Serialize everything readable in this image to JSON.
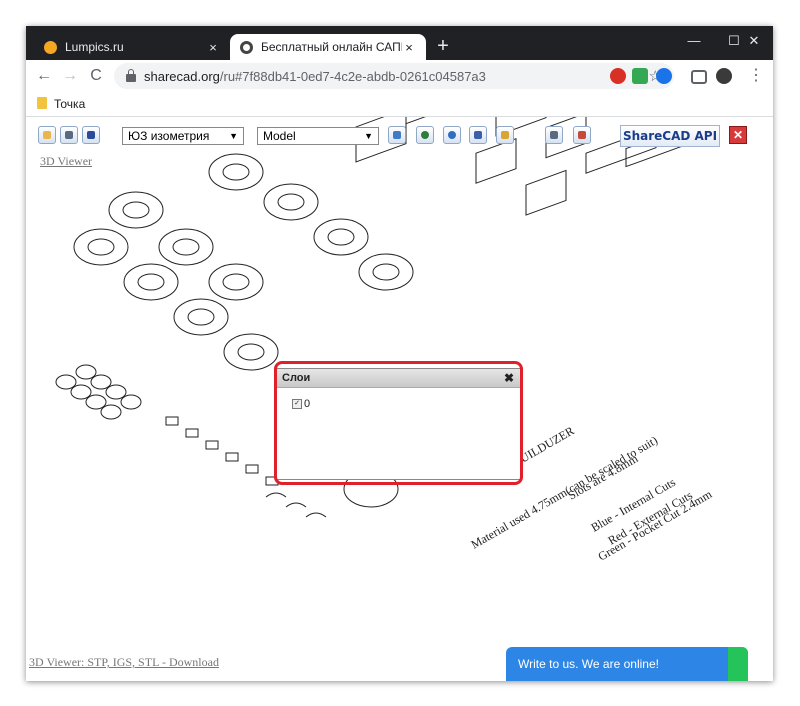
{
  "browser": {
    "tabs": [
      {
        "title": "Lumpics.ru",
        "active": false
      },
      {
        "title": "Бесплатный онлайн САПР прос",
        "active": true
      }
    ],
    "new_tab_symbol": "+",
    "close_symbol": "×",
    "window_controls": {
      "minimize": "—",
      "maximize": "☐",
      "close": "✕"
    },
    "nav": {
      "back": "←",
      "forward": "→",
      "reload": "C"
    },
    "url": {
      "host": "sharecad.org",
      "path": "/ru#7f88db41-0ed7-4c2e-abdb-0261c04587a3"
    },
    "bookmark_star": "☆",
    "menu_symbol": "⋮",
    "bookmarks": [
      {
        "label": "Точка"
      }
    ]
  },
  "cad": {
    "view_select": "ЮЗ изометрия",
    "layout_select": "Model",
    "api_button": "ShareCAD API",
    "close_button": "✕",
    "viewer_link": "3D Viewer",
    "download_link": "3D Viewer: STP, IGS, STL - Download",
    "drawing_notes": [
      "BUILDUZER",
      "Material used 4.75mm(can be scaled to suit)",
      "Slots are 4.8mm",
      "Blue - Internal Cuts",
      "Red - External Cuts",
      "Green - Pocket Cut 2.4mm"
    ]
  },
  "layers_dialog": {
    "title": "Слои",
    "close_symbol": "✖",
    "layers": [
      {
        "name": "0",
        "checked": true
      }
    ]
  },
  "chat": {
    "label": "Write to us. We are online!"
  },
  "colors": {
    "highlight": "#e0202a",
    "chat": "#2d86e6",
    "titlebar": "#202124"
  }
}
